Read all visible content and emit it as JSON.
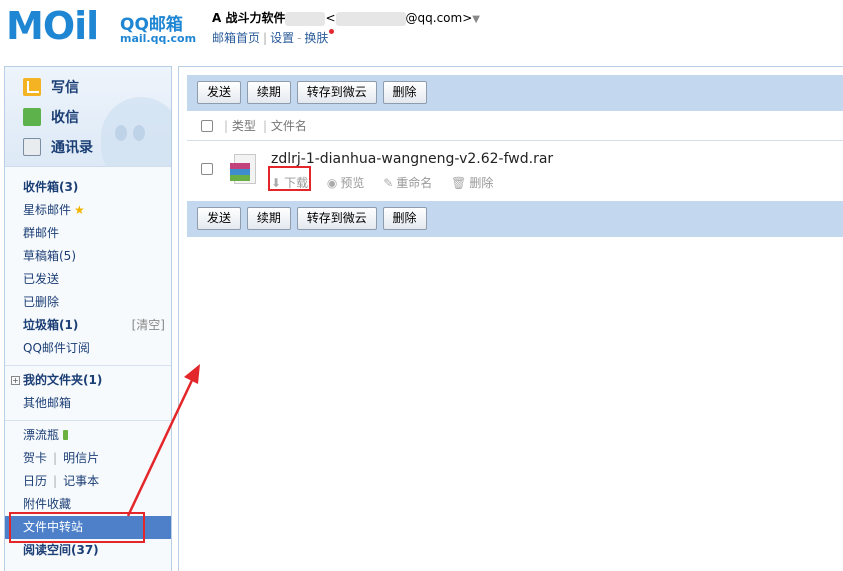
{
  "header": {
    "logo_word": "MOil",
    "logo_title": "QQ邮箱",
    "logo_url": "mail.qq.com",
    "user_prefix": "A 战斗力软件",
    "email_suffix": "@qq.com>",
    "home_link": "邮箱首页",
    "settings_link": "设置",
    "skin_link": "换肤"
  },
  "quick": {
    "compose": "写信",
    "receive": "收信",
    "contacts": "通讯录"
  },
  "nav": {
    "inbox": "收件箱(3)",
    "starred": "星标邮件",
    "group": "群邮件",
    "drafts": "草稿箱(5)",
    "sent": "已发送",
    "deleted": "已删除",
    "spam": "垃圾箱(1)",
    "spam_clear": "[清空]",
    "subscriptions": "QQ邮件订阅",
    "my_folders": "我的文件夹(1)",
    "other_mailboxes": "其他邮箱",
    "drift_bottle": "漂流瓶",
    "greeting_card": "贺卡",
    "postcard": "明信片",
    "calendar": "日历",
    "notebook": "记事本",
    "attachments": "附件收藏",
    "file_transfer": "文件中转站",
    "reading_space": "阅读空间(37)"
  },
  "toolbar": {
    "send": "发送",
    "renew": "续期",
    "save_weiyun": "转存到微云",
    "delete": "删除"
  },
  "list": {
    "col_type": "类型",
    "col_name": "文件名",
    "files": [
      {
        "name": "zdlrj-1-dianhua-wangneng-v2.62-fwd.rar",
        "download": "下载",
        "preview": "预览",
        "rename": "重命名",
        "delete": "删除"
      }
    ]
  },
  "colors": {
    "brand": "#1f86d4",
    "toolbar_bg": "#c3d7ef",
    "active_nav": "#4d80c9",
    "highlight": "#e3262a"
  }
}
